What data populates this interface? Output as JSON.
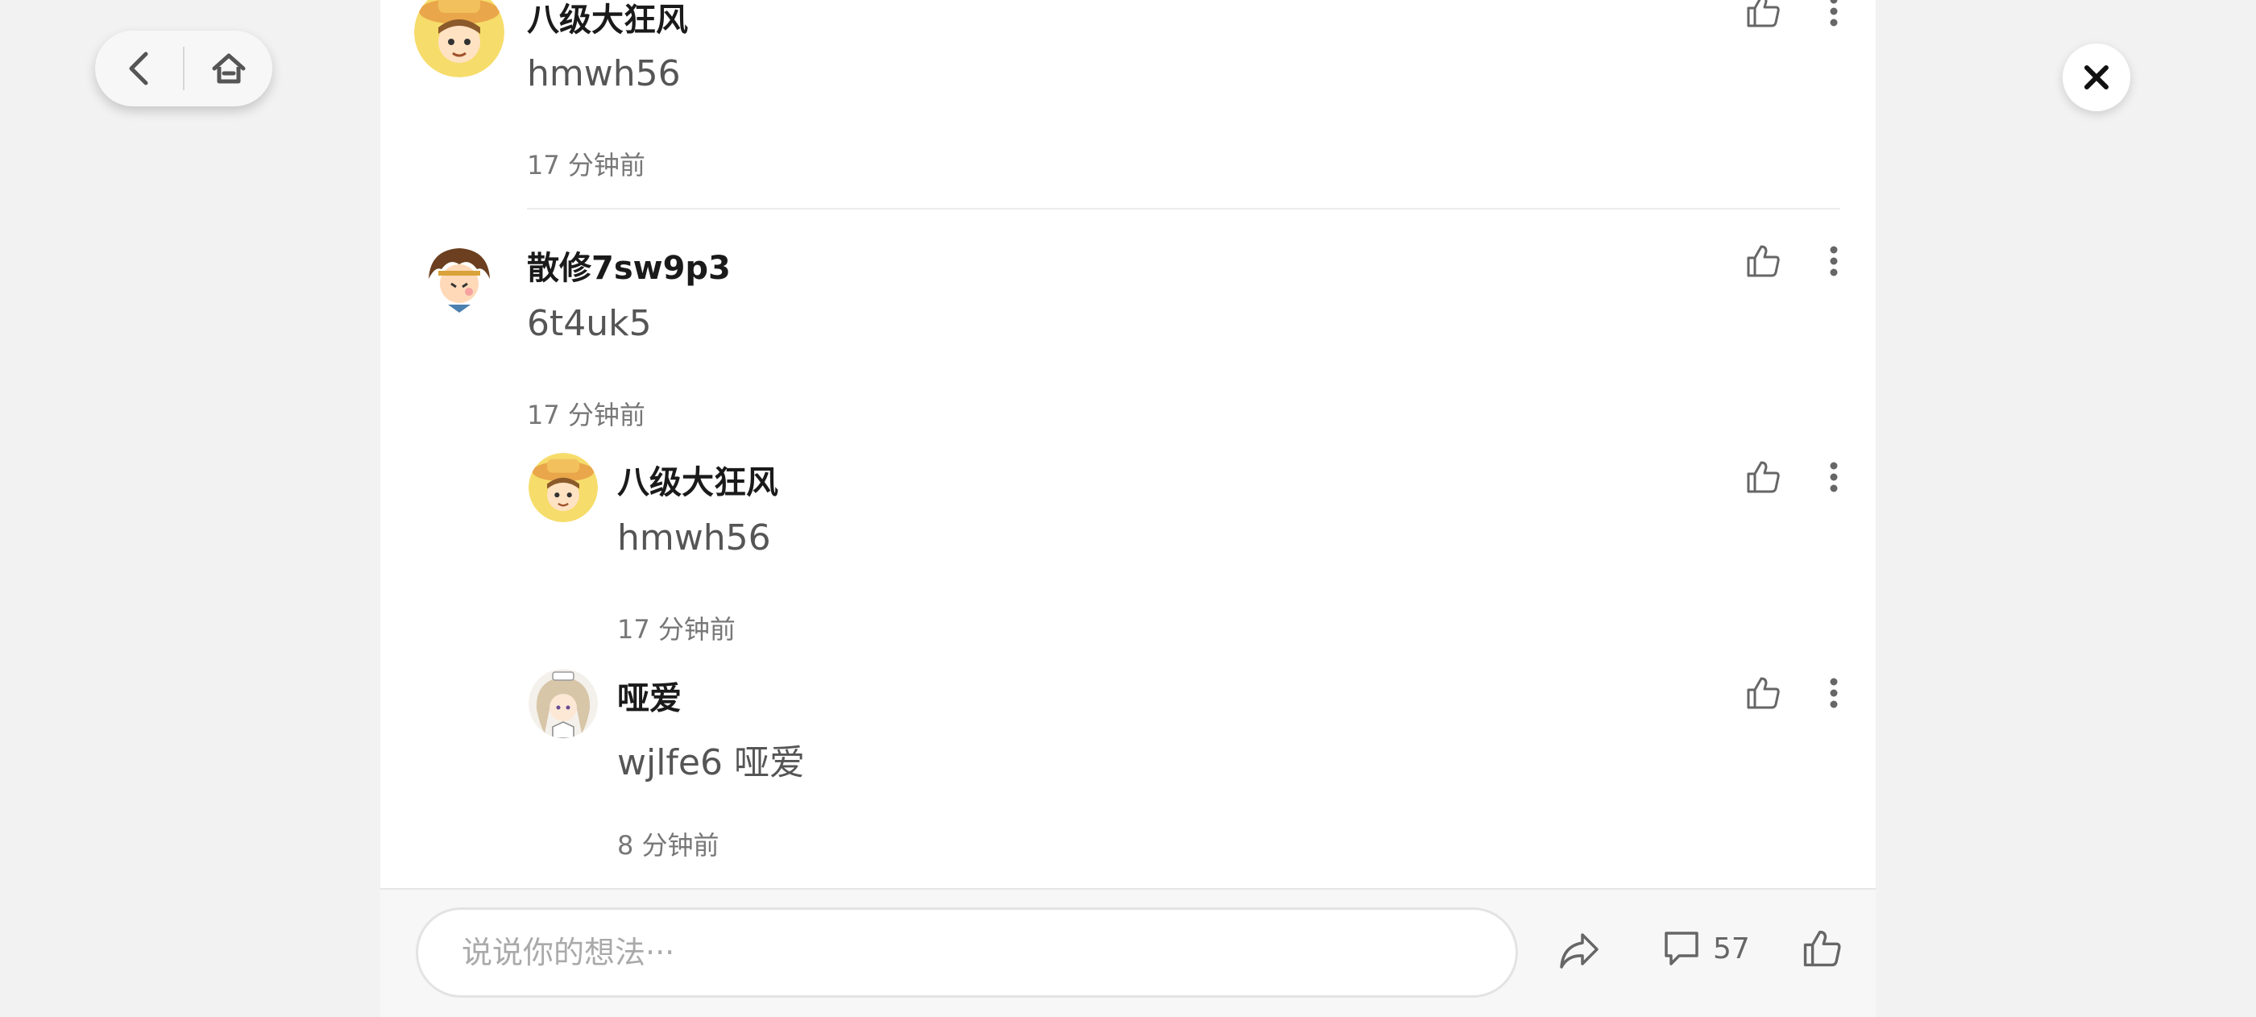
{
  "comments": [
    {
      "name": "八级大狂风",
      "text": "hmwh56",
      "time": "17 分钟前"
    },
    {
      "name": "散修7sw9p3",
      "text": "6t4uk5",
      "time": "17 分钟前"
    },
    {
      "name": "八级大狂风",
      "text": "hmwh56",
      "time": "17 分钟前"
    },
    {
      "name": "哑爱",
      "text": "wjlfe6 哑爱",
      "time": "8 分钟前"
    }
  ],
  "bottom_bar": {
    "input_placeholder": "说说你的想法···",
    "comment_count": "57"
  },
  "colors": {
    "page_bg": "#f2f2f2",
    "panel_bg": "#ffffff",
    "icon": "#666666"
  },
  "icons": [
    "back-icon",
    "home-icon",
    "close-icon",
    "thumbs-up-icon",
    "more-vertical-icon",
    "share-icon",
    "comment-icon"
  ]
}
